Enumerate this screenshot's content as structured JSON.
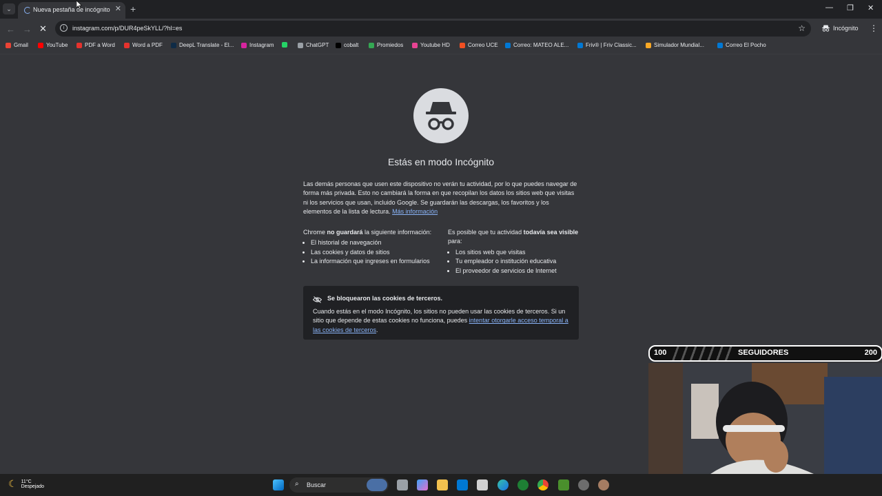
{
  "tab": {
    "title": "Nueva pestaña de incógnito"
  },
  "toolbar": {
    "url": "instagram.com/p/DUR4peSkYLL/?hl=es",
    "profile_label": "Incógnito"
  },
  "bookmarks": [
    {
      "label": "Gmail",
      "icon": "gmail-icon",
      "color": "#ea4335"
    },
    {
      "label": "YouTube",
      "icon": "youtube-icon",
      "color": "#ff0000"
    },
    {
      "label": "PDF a Word",
      "icon": "heart-icon",
      "color": "#e5322d"
    },
    {
      "label": "Word a PDF",
      "icon": "heart-icon",
      "color": "#e5322d"
    },
    {
      "label": "DeepL Translate - El...",
      "icon": "deepl-icon",
      "color": "#0f2b46"
    },
    {
      "label": "Instagram",
      "icon": "instagram-icon",
      "color": "#d6249f"
    },
    {
      "label": "",
      "icon": "whatsapp-icon",
      "color": "#25d366"
    },
    {
      "label": "ChatGPT",
      "icon": "chatgpt-icon",
      "color": "#9aa0a6"
    },
    {
      "label": "cobalt",
      "icon": "cobalt-icon",
      "color": "#000000"
    },
    {
      "label": "Promiedos",
      "icon": "promiedos-icon",
      "color": "#34a853"
    },
    {
      "label": "Youtube HD",
      "icon": "youtube-hd-icon",
      "color": "#e84393"
    },
    {
      "label": "Correo UCE",
      "icon": "microsoft-icon",
      "color": "#f25022"
    },
    {
      "label": "Correo: MATEO ALE...",
      "icon": "outlook-icon",
      "color": "#0078d4"
    },
    {
      "label": "Friv® | Friv Classic...",
      "icon": "friv-icon",
      "color": "#0078d4"
    },
    {
      "label": "Simulador Mundial...",
      "icon": "simulador-icon",
      "color": "#f9a825"
    },
    {
      "label": "Correo El Pocho",
      "icon": "outlook-icon",
      "color": "#0078d4"
    }
  ],
  "incognito": {
    "heading": "Estás en modo Incógnito",
    "intro": "Las demás personas que usen este dispositivo no verán tu actividad, por lo que puedes navegar de forma más privada. Esto no cambiará la forma en que recopilan los datos los sitios web que visitas ni los servicios que usan, incluido Google. Se guardarán las descargas, los favoritos y los elementos de la lista de lectura.",
    "more_info_link": "Más información",
    "left_col": {
      "heading_pre": "Chrome ",
      "heading_bold": "no guardará",
      "heading_post": " la siguiente información:",
      "items": [
        "El historial de navegación",
        "Las cookies y datos de sitios",
        "La información que ingreses en formularios"
      ]
    },
    "right_col": {
      "heading_pre": "Es posible que tu actividad ",
      "heading_bold": "todavía sea visible",
      "heading_post": " para:",
      "items": [
        "Los sitios web que visitas",
        "Tu empleador o institución educativa",
        "El proveedor de servicios de Internet"
      ]
    },
    "cookies": {
      "title": "Se bloquearon las cookies de terceros.",
      "body": "Cuando estás en el modo Incógnito, los sitios no pueden usar las cookies de terceros. Si un sitio que depende de estas cookies no funciona, puedes ",
      "link": "intentar otorgarle acceso temporal a las cookies de terceros",
      "end": "."
    }
  },
  "overlay": {
    "goal_start": "100",
    "goal_label": "SEGUIDORES",
    "goal_end": "200"
  },
  "taskbar": {
    "temperature": "11°C",
    "condition": "Despejado",
    "search_placeholder": "Buscar"
  }
}
